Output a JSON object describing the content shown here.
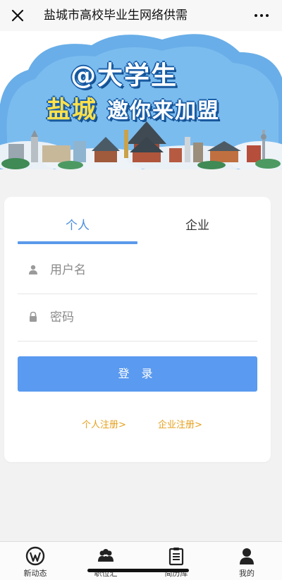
{
  "header": {
    "title": "盐城市高校毕业生网络供需",
    "close_icon": "close-icon",
    "more_icon": "more-dots-icon"
  },
  "banner": {
    "line1": "@大学生",
    "line2_city": "盐城",
    "line2_rest": "邀你来加盟",
    "colors": {
      "sky": "#6aaee6",
      "cloud": "#ffffff",
      "city_text": "#ffe14a"
    }
  },
  "login": {
    "tabs": [
      {
        "label": "个人",
        "active": true
      },
      {
        "label": "企业",
        "active": false
      }
    ],
    "username_placeholder": "用户名",
    "password_placeholder": "密码",
    "username_icon": "user-icon",
    "password_icon": "lock-icon",
    "submit_label": "登 录",
    "register_personal": "个人注册>",
    "register_company": "企业注册>",
    "accent_color": "#5a9af0",
    "link_color": "#e6a01c"
  },
  "tabbar": {
    "items": [
      {
        "label": "新动态",
        "icon": "wordpress-icon"
      },
      {
        "label": "职位汇",
        "icon": "people-icon"
      },
      {
        "label": "简历库",
        "icon": "clipboard-icon"
      },
      {
        "label": "我的",
        "icon": "person-icon"
      }
    ]
  }
}
